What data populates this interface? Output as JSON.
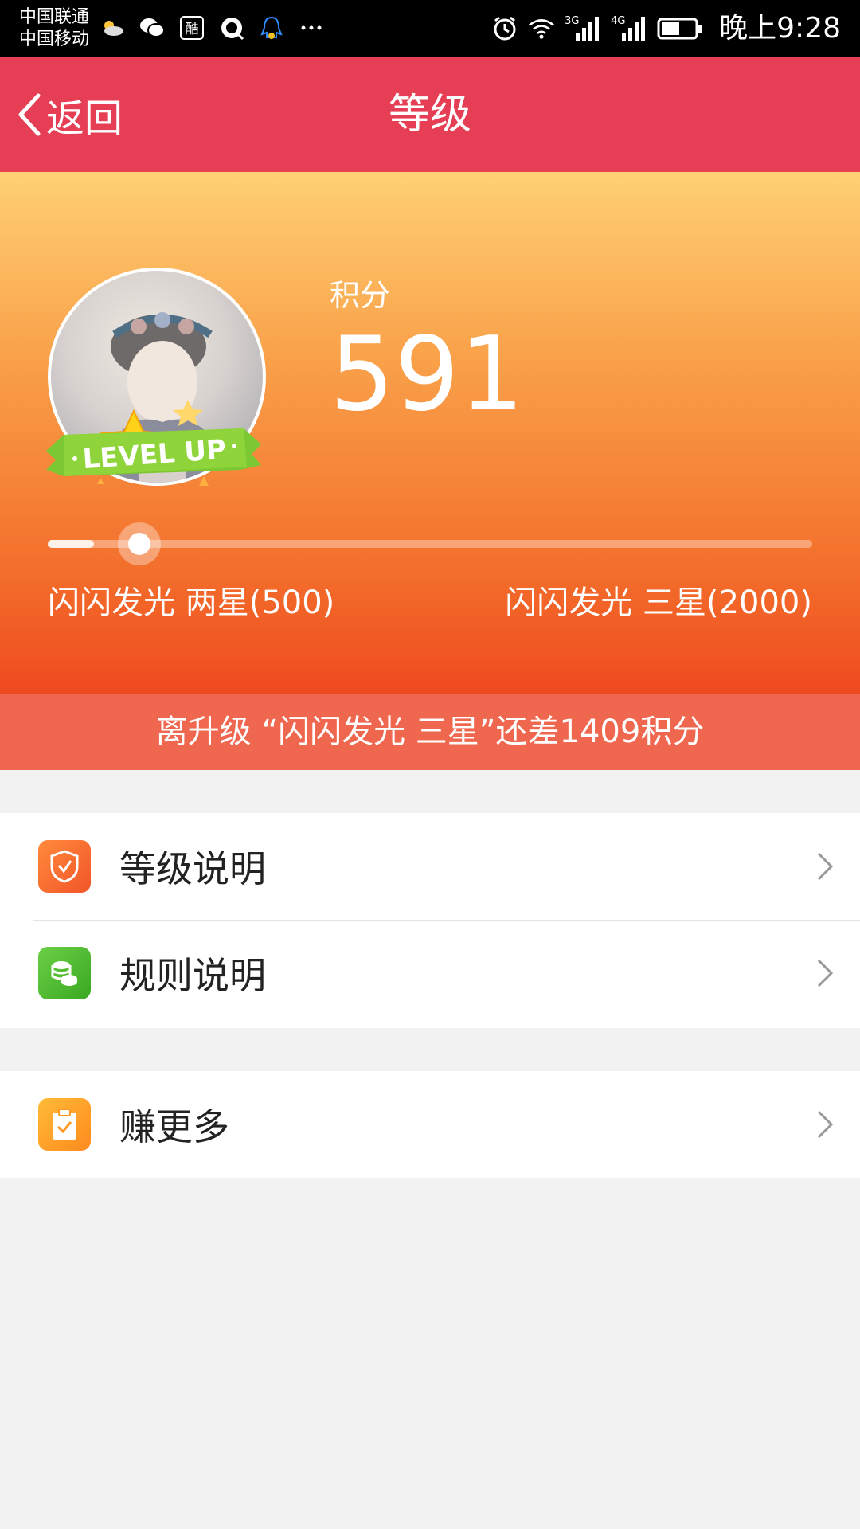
{
  "status_bar": {
    "carrier_1": "中国联通",
    "carrier_2": "中国移动",
    "network_1": "3G",
    "network_2": "4G",
    "time": "晚上9:28",
    "left_icons": [
      "weather-icon",
      "wechat-icon",
      "kuwo-icon",
      "app-icon",
      "qq-icon",
      "more-icon"
    ],
    "right_icons": [
      "alarm-icon",
      "wifi-icon",
      "signal-icon",
      "battery-icon"
    ]
  },
  "header": {
    "back_label": "返回",
    "title": "等级"
  },
  "hero": {
    "points_label": "积分",
    "points_value": "591",
    "current_level": "闪闪发光 两星(500)",
    "next_level": "闪闪发光 三星(2000)",
    "progress_fraction": 0.06,
    "badge_text": "LEVEL UP"
  },
  "upgrade_notice": "离升级 “闪闪发光 三星”还差1409积分",
  "menu_group_1": [
    {
      "label": "等级说明",
      "icon": "shield-check-icon",
      "color": "#f2552a"
    },
    {
      "label": "规则说明",
      "icon": "coins-icon",
      "color": "#39a820"
    }
  ],
  "menu_group_2": [
    {
      "label": "赚更多",
      "icon": "clipboard-check-icon",
      "color": "#ff8a1e"
    }
  ],
  "colors": {
    "nav_bg": "#e63f55",
    "notice_bg": "#f0674f",
    "page_bg": "#f2f2f2"
  }
}
